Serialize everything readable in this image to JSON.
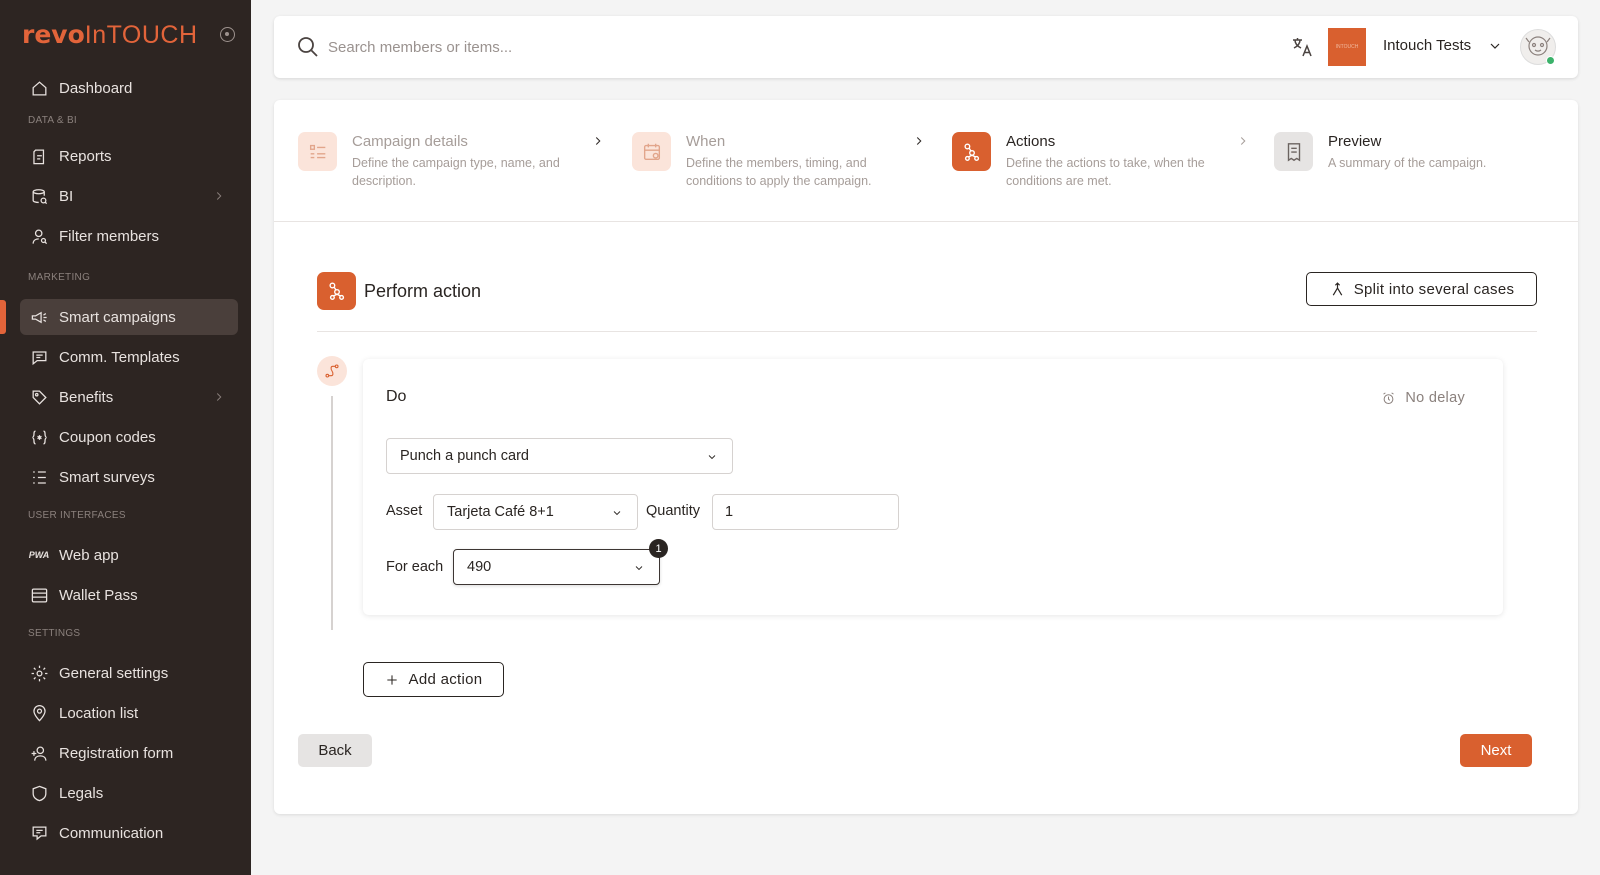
{
  "brand": {
    "logo_bold": "revo",
    "logo_light": "InTOUCH"
  },
  "sidebar": {
    "sections": {
      "data_bi": "DATA & BI",
      "marketing": "MARKETING",
      "user_interfaces": "USER INTERFACES",
      "settings": "SETTINGS"
    },
    "items": [
      {
        "label": "Dashboard",
        "icon": "home-icon"
      },
      {
        "label": "Reports",
        "icon": "report-icon"
      },
      {
        "label": "BI",
        "icon": "database-search-icon"
      },
      {
        "label": "Filter members",
        "icon": "user-search-icon"
      },
      {
        "label": "Smart campaigns",
        "icon": "megaphone-icon",
        "active": true
      },
      {
        "label": "Comm. Templates",
        "icon": "message-icon"
      },
      {
        "label": "Benefits",
        "icon": "tag-icon"
      },
      {
        "label": "Coupon codes",
        "icon": "braces-asterisk-icon"
      },
      {
        "label": "Smart surveys",
        "icon": "list-icon"
      },
      {
        "label": "Web app",
        "icon": "pwa-icon"
      },
      {
        "label": "Wallet Pass",
        "icon": "wallet-icon"
      },
      {
        "label": "General settings",
        "icon": "gear-icon"
      },
      {
        "label": "Location list",
        "icon": "location-pin-icon"
      },
      {
        "label": "Registration form",
        "icon": "user-plus-icon"
      },
      {
        "label": "Legals",
        "icon": "shield-icon"
      },
      {
        "label": "Communication",
        "icon": "chat-settings-icon"
      }
    ],
    "pwa_glyph": "PWA"
  },
  "topbar": {
    "search_placeholder": "Search members or items...",
    "brand_tile_text": "INTOUCH",
    "account_name": "Intouch Tests"
  },
  "steps": [
    {
      "title": "Campaign details",
      "desc": "Define the campaign type, name, and description.",
      "state": "done"
    },
    {
      "title": "When",
      "desc": "Define the members, timing, and conditions to apply the campaign.",
      "state": "done"
    },
    {
      "title": "Actions",
      "desc": "Define the actions to take, when the conditions are met.",
      "state": "active"
    },
    {
      "title": "Preview",
      "desc": "A summary of the campaign.",
      "state": "pending"
    }
  ],
  "action_section": {
    "title": "Perform action",
    "split_label": "Split into several cases",
    "do_label": "Do",
    "delay_label": "No delay",
    "action_select": "Punch a punch card",
    "asset_label": "Asset",
    "asset_value": "Tarjeta Café 8+1",
    "quantity_label": "Quantity",
    "quantity_value": "1",
    "for_each_label": "For each",
    "for_each_value": "490",
    "for_each_badge": "1",
    "add_action_label": "Add action"
  },
  "footer": {
    "back_label": "Back",
    "next_label": "Next"
  },
  "colors": {
    "accent": "#d9602f",
    "sidebar_bg": "#2d2522",
    "active_item_bg": "#4a3f3b"
  }
}
